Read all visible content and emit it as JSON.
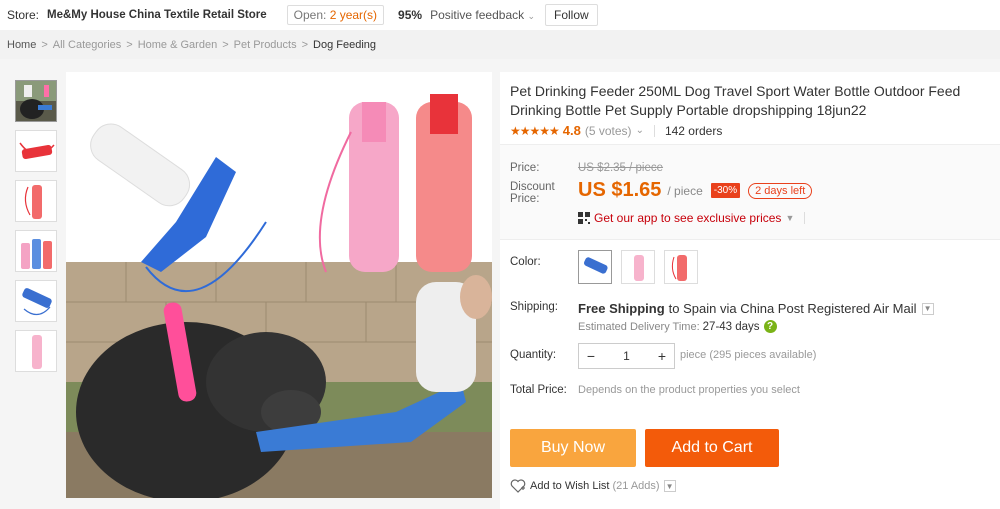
{
  "store": {
    "label": "Store:",
    "name": "Me&My House China Textile Retail Store",
    "open_prefix": "Open:",
    "open_years": "2 year(s)",
    "feedback_pct": "95%",
    "feedback_label": "Positive feedback",
    "follow": "Follow"
  },
  "breadcrumb": [
    "Home",
    "All Categories",
    "Home & Garden",
    "Pet Products",
    "Dog Feeding"
  ],
  "product": {
    "title": "Pet Drinking Feeder 250ML Dog Travel Sport Water Bottle Outdoor Feed Drinking Bottle Pet Supply Portable dropshipping 18jun22",
    "rating_value": "4.8",
    "votes": "(5 votes)",
    "orders": "142 orders"
  },
  "price": {
    "price_label": "Price:",
    "old_price": "US $2.35 / piece",
    "discount_label": "Discount Price:",
    "new_price": "US $1.65",
    "per": "/ piece",
    "discount_badge": "-30%",
    "days_left": "2 days left",
    "app_text": "Get our app to see exclusive prices"
  },
  "options": {
    "color_label": "Color:",
    "shipping_label": "Shipping:",
    "shipping_free": "Free Shipping",
    "shipping_rest": "to Spain via China Post Registered Air Mail",
    "eta_label": "Estimated Delivery Time:",
    "eta_days": "27-43 days",
    "quantity_label": "Quantity:",
    "quantity_value": "1",
    "available": "piece (295 pieces available)",
    "total_label": "Total Price:",
    "total_desc": "Depends on the product properties you select"
  },
  "actions": {
    "buy_now": "Buy Now",
    "add_to_cart": "Add to Cart",
    "wish": "Add to Wish List",
    "wish_adds": "(21 Adds)"
  },
  "colors": {
    "accent": "#e56600",
    "buy_now": "#f9a53e",
    "add_to_cart": "#f35b0a",
    "discount_badge": "#e9411c",
    "app_link": "#c7000b"
  }
}
